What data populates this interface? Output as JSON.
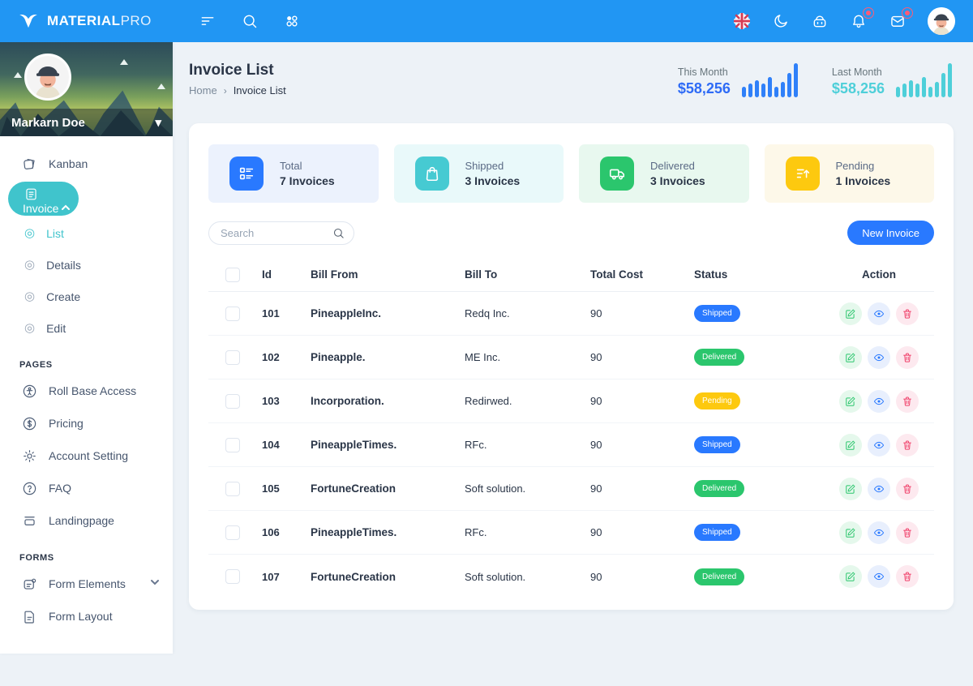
{
  "colors": {
    "navbar": "#2196f3",
    "sidebar_active": "#40c4cc",
    "accent_blue": "#2979ff",
    "accent_teal": "#46cad2",
    "accent_green": "#2bc66d",
    "accent_yellow": "#fdc90f",
    "badge_red": "#ff5b77"
  },
  "navbar": {
    "brand_bold": "MATERIAL",
    "brand_light": "PRO"
  },
  "profile": {
    "name": "Markarn Doe"
  },
  "sidebar": {
    "kanban_label": "Kanban",
    "invoice_label": "Invoice",
    "list_label": "List",
    "details_label": "Details",
    "create_label": "Create",
    "edit_label": "Edit",
    "pages_heading": "PAGES",
    "roll_base_access_label": "Roll Base Access",
    "pricing_label": "Pricing",
    "account_setting_label": "Account Setting",
    "faq_label": "FAQ",
    "landingpage_label": "Landingpage",
    "forms_heading": "FORMS",
    "form_elements_label": "Form Elements",
    "form_layout_label": "Form Layout"
  },
  "header": {
    "title": "Invoice List",
    "breadcrumb_home": "Home",
    "breadcrumb_sep": "›",
    "breadcrumb_current": "Invoice List",
    "this_month": {
      "label": "This Month",
      "value": "$58,256",
      "value_color": "#2e6bf6",
      "spark_color": "#2f80f9",
      "spark": [
        13,
        17,
        21,
        17,
        25,
        13,
        19,
        30,
        42
      ]
    },
    "last_month": {
      "label": "Last Month",
      "value": "$58,256",
      "value_color": "#4ecfd9",
      "spark_color": "#4ecfd9",
      "spark": [
        13,
        17,
        21,
        17,
        25,
        13,
        19,
        30,
        42
      ]
    }
  },
  "cards": [
    {
      "label": "Total",
      "count": "7 Invoices",
      "color": "#2979ff",
      "bg": "#ecf2fd",
      "icon": "invoice-list-icon"
    },
    {
      "label": "Shipped",
      "count": "3 Invoices",
      "color": "#46cad2",
      "bg": "#e9f9fa",
      "icon": "bag-icon"
    },
    {
      "label": "Delivered",
      "count": "3 Invoices",
      "color": "#2bc66d",
      "bg": "#e8f8ef",
      "icon": "truck-icon"
    },
    {
      "label": "Pending",
      "count": "1 Invoices",
      "color": "#fdc90f",
      "bg": "#fdf8e9",
      "icon": "sort-up-icon"
    }
  ],
  "toolbar": {
    "search_placeholder": "Search",
    "new_invoice_label": "New Invoice"
  },
  "table": {
    "headers": {
      "id": "Id",
      "bill_from": "Bill From",
      "bill_to": "Bill To",
      "total_cost": "Total Cost",
      "status": "Status",
      "action": "Action"
    },
    "rows": [
      {
        "id": "101",
        "bill_from": "PineappleInc.",
        "bill_to": "Redq Inc.",
        "total_cost": "90",
        "status": "Shipped",
        "status_color": "#2979ff"
      },
      {
        "id": "102",
        "bill_from": "Pineapple.",
        "bill_to": "ME Inc.",
        "total_cost": "90",
        "status": "Delivered",
        "status_color": "#2bc66d"
      },
      {
        "id": "103",
        "bill_from": "Incorporation.",
        "bill_to": "Redirwed.",
        "total_cost": "90",
        "status": "Pending",
        "status_color": "#fdc90f"
      },
      {
        "id": "104",
        "bill_from": "PineappleTimes.",
        "bill_to": "RFc.",
        "total_cost": "90",
        "status": "Shipped",
        "status_color": "#2979ff"
      },
      {
        "id": "105",
        "bill_from": "FortuneCreation",
        "bill_to": "Soft solution.",
        "total_cost": "90",
        "status": "Delivered",
        "status_color": "#2bc66d"
      },
      {
        "id": "106",
        "bill_from": "PineappleTimes.",
        "bill_to": "RFc.",
        "total_cost": "90",
        "status": "Shipped",
        "status_color": "#2979ff"
      },
      {
        "id": "107",
        "bill_from": "FortuneCreation",
        "bill_to": "Soft solution.",
        "total_cost": "90",
        "status": "Delivered",
        "status_color": "#2bc66d"
      }
    ]
  }
}
